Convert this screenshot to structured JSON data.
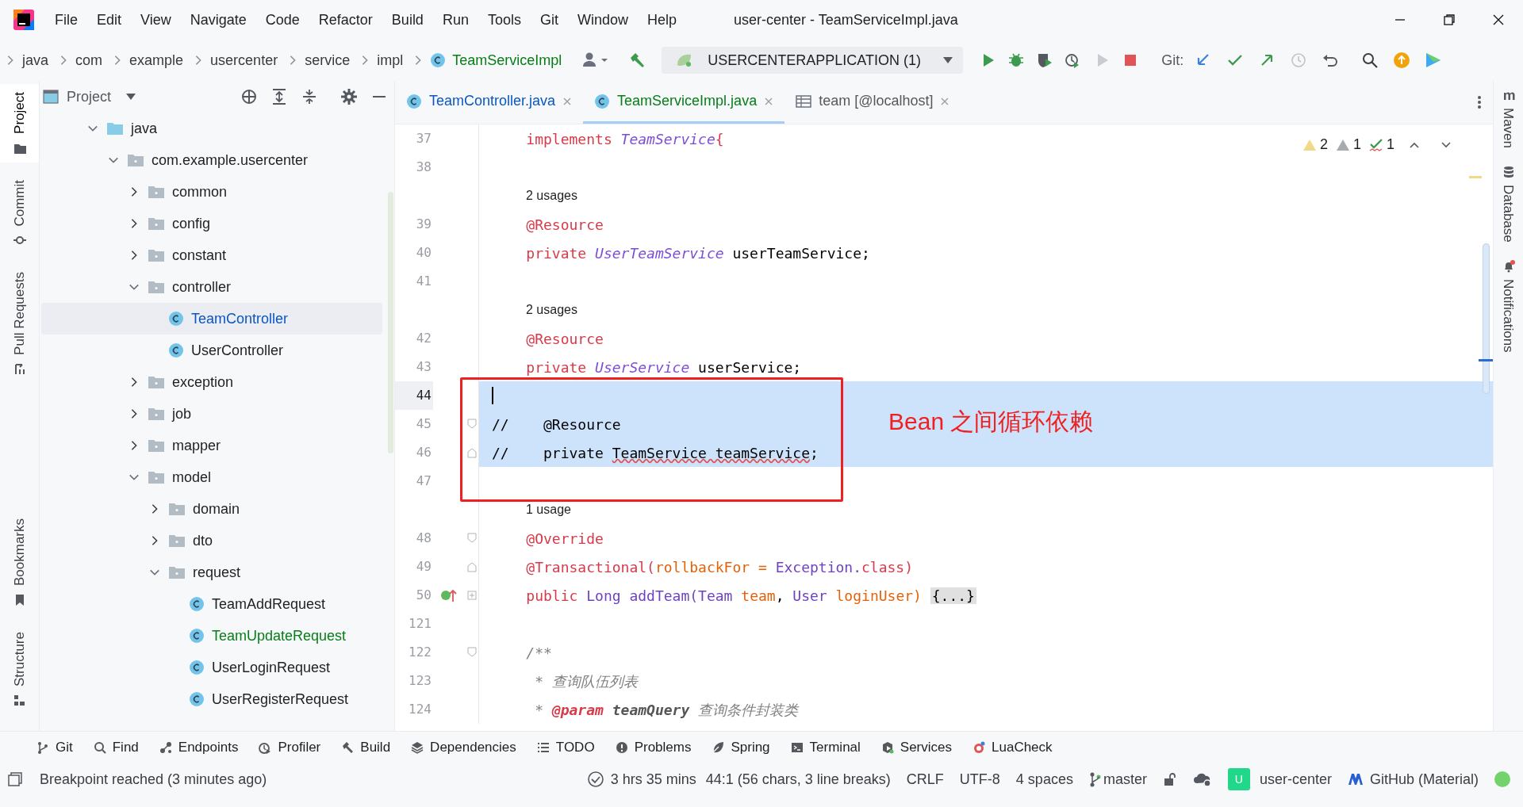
{
  "window": {
    "title": "user-center - TeamServiceImpl.java"
  },
  "menu": [
    "File",
    "Edit",
    "View",
    "Navigate",
    "Code",
    "Refactor",
    "Build",
    "Run",
    "Tools",
    "Git",
    "Window",
    "Help"
  ],
  "breadcrumbs": [
    {
      "label": "java",
      "kind": "folder"
    },
    {
      "label": "com",
      "kind": "folder"
    },
    {
      "label": "example",
      "kind": "folder"
    },
    {
      "label": "usercenter",
      "kind": "folder"
    },
    {
      "label": "service",
      "kind": "folder"
    },
    {
      "label": "impl",
      "kind": "folder"
    },
    {
      "label": "TeamServiceImpl",
      "kind": "class"
    }
  ],
  "run_config": {
    "label": "USERCENTERAPPLICATION (1)"
  },
  "git_label": "Git:",
  "left_stripe": {
    "top": [
      {
        "label": "Project",
        "selected": true
      },
      {
        "label": "Commit",
        "selected": false
      },
      {
        "label": "Pull Requests",
        "selected": false
      }
    ],
    "bottom": [
      {
        "label": "Bookmarks",
        "selected": false
      },
      {
        "label": "Structure",
        "selected": false
      }
    ]
  },
  "right_stripe": [
    {
      "label": "Maven",
      "badge": false
    },
    {
      "label": "Database",
      "badge": false
    },
    {
      "label": "Notifications",
      "badge": true
    }
  ],
  "project_panel": {
    "title": "Project",
    "tree": [
      {
        "label": "java",
        "kind": "source-root",
        "expanded": true,
        "selected": false,
        "modified": false,
        "added": false,
        "children": [
          {
            "label": "com.example.usercenter",
            "kind": "package",
            "expanded": true,
            "selected": false,
            "modified": false,
            "added": false,
            "children": [
              {
                "label": "common",
                "kind": "package",
                "expanded": false,
                "selected": false,
                "modified": false,
                "added": false
              },
              {
                "label": "config",
                "kind": "package",
                "expanded": false,
                "selected": false,
                "modified": false,
                "added": false
              },
              {
                "label": "constant",
                "kind": "package",
                "expanded": false,
                "selected": false,
                "modified": false,
                "added": false
              },
              {
                "label": "controller",
                "kind": "package",
                "expanded": true,
                "selected": false,
                "modified": false,
                "added": false,
                "children": [
                  {
                    "label": "TeamController",
                    "kind": "class",
                    "selected": true,
                    "modified": true,
                    "added": false
                  },
                  {
                    "label": "UserController",
                    "kind": "class",
                    "selected": false,
                    "modified": false,
                    "added": false
                  }
                ]
              },
              {
                "label": "exception",
                "kind": "package",
                "expanded": false,
                "selected": false,
                "modified": false,
                "added": false
              },
              {
                "label": "job",
                "kind": "package",
                "expanded": false,
                "selected": false,
                "modified": false,
                "added": false
              },
              {
                "label": "mapper",
                "kind": "package",
                "expanded": false,
                "selected": false,
                "modified": false,
                "added": false
              },
              {
                "label": "model",
                "kind": "package",
                "expanded": true,
                "selected": false,
                "modified": false,
                "added": false,
                "children": [
                  {
                    "label": "domain",
                    "kind": "package",
                    "expanded": false,
                    "selected": false,
                    "modified": false,
                    "added": false
                  },
                  {
                    "label": "dto",
                    "kind": "package",
                    "expanded": false,
                    "selected": false,
                    "modified": false,
                    "added": false
                  },
                  {
                    "label": "request",
                    "kind": "package",
                    "expanded": true,
                    "selected": false,
                    "modified": false,
                    "added": false,
                    "children": [
                      {
                        "label": "TeamAddRequest",
                        "kind": "class",
                        "selected": false,
                        "modified": false,
                        "added": false
                      },
                      {
                        "label": "TeamUpdateRequest",
                        "kind": "class",
                        "selected": false,
                        "modified": false,
                        "added": true
                      },
                      {
                        "label": "UserLoginRequest",
                        "kind": "class",
                        "selected": false,
                        "modified": false,
                        "added": false
                      },
                      {
                        "label": "UserRegisterRequest",
                        "kind": "class",
                        "selected": false,
                        "modified": false,
                        "added": false
                      }
                    ]
                  }
                ]
              }
            ]
          }
        ]
      }
    ]
  },
  "tabs": [
    {
      "label": "TeamController.java",
      "kind": "class",
      "selected": false,
      "modified": true,
      "added": false
    },
    {
      "label": "TeamServiceImpl.java",
      "kind": "class",
      "selected": true,
      "modified": false,
      "added": true
    },
    {
      "label": "team [@localhost]",
      "kind": "table",
      "selected": false,
      "modified": false,
      "added": false
    }
  ],
  "inspections": {
    "warnings": "2",
    "weak_warnings": "1",
    "typos": "1"
  },
  "code": [
    {
      "kind": "code",
      "number": "37",
      "tokens": [
        {
          "text": "    implements ",
          "kind": "keyword"
        },
        {
          "text": "TeamService",
          "kind": "type"
        },
        {
          "text": "{",
          "kind": "keyword"
        }
      ]
    },
    {
      "kind": "code",
      "number": "38"
    },
    {
      "kind": "usages",
      "text": "2 usages"
    },
    {
      "kind": "code",
      "number": "39",
      "tokens": [
        {
          "text": "    @Resource",
          "kind": "annotation"
        }
      ]
    },
    {
      "kind": "code",
      "number": "40",
      "tokens": [
        {
          "text": "    private ",
          "kind": "keyword"
        },
        {
          "text": "UserTeamService",
          "kind": "type"
        },
        {
          "text": " userTeamService;",
          "kind": "plain"
        }
      ]
    },
    {
      "kind": "code",
      "number": "41"
    },
    {
      "kind": "usages",
      "text": "2 usages"
    },
    {
      "kind": "code",
      "number": "42",
      "tokens": [
        {
          "text": "    @Resource",
          "kind": "annotation"
        }
      ]
    },
    {
      "kind": "code",
      "number": "43",
      "tokens": [
        {
          "text": "    private ",
          "kind": "keyword"
        },
        {
          "text": "UserService",
          "kind": "type"
        },
        {
          "text": " userService;",
          "kind": "plain"
        }
      ]
    },
    {
      "kind": "code",
      "number": "44",
      "highlighted": true,
      "current": true
    },
    {
      "kind": "code",
      "number": "45",
      "tokens": [
        {
          "text": "//    @Resource",
          "kind": "plain"
        }
      ],
      "highlighted": true,
      "fold_open": true
    },
    {
      "kind": "code",
      "number": "46",
      "tokens": [
        {
          "text": "//    private ",
          "kind": "plain"
        },
        {
          "text": "TeamService teamService",
          "kind": "squiggle"
        },
        {
          "text": ";",
          "kind": "plain"
        }
      ],
      "highlighted": true,
      "fold_close": true
    },
    {
      "kind": "code",
      "number": "47"
    },
    {
      "kind": "usages",
      "text": "1 usage"
    },
    {
      "kind": "code",
      "number": "48",
      "tokens": [
        {
          "text": "    @Override",
          "kind": "annotation"
        }
      ],
      "fold_open": true
    },
    {
      "kind": "code",
      "number": "49",
      "tokens": [
        {
          "text": "    @Transactional(",
          "kind": "annotation"
        },
        {
          "text": "rollbackFor = ",
          "kind": "param"
        },
        {
          "text": "Exception.",
          "kind": "class"
        },
        {
          "text": "class",
          "kind": "keyword"
        },
        {
          "text": ")",
          "kind": "annotation"
        }
      ],
      "fold_close": true
    },
    {
      "kind": "code",
      "number": "50",
      "tokens": [
        {
          "text": "    public ",
          "kind": "keyword"
        },
        {
          "text": "Long ",
          "kind": "class"
        },
        {
          "text": "addTeam(",
          "kind": "method"
        },
        {
          "text": "Team ",
          "kind": "class"
        },
        {
          "text": "team",
          "kind": "param"
        },
        {
          "text": ", ",
          "kind": "plain"
        },
        {
          "text": "User ",
          "kind": "class"
        },
        {
          "text": "loginUser) ",
          "kind": "param"
        },
        {
          "text": "{...}",
          "kind": "folded"
        }
      ],
      "collapsed": true,
      "implements": true
    },
    {
      "kind": "code",
      "number": "121"
    },
    {
      "kind": "code",
      "number": "122",
      "tokens": [
        {
          "text": "    /**",
          "kind": "doc"
        }
      ],
      "fold_open": true
    },
    {
      "kind": "code",
      "number": "123",
      "tokens": [
        {
          "text": "     * 查询队伍列表",
          "kind": "doc"
        }
      ]
    },
    {
      "kind": "code",
      "number": "124",
      "tokens": [
        {
          "text": "     * ",
          "kind": "doc"
        },
        {
          "text": "@param",
          "kind": "doctag"
        },
        {
          "text": " teamQuery",
          "kind": "docparam"
        },
        {
          "text": " 查询条件封装类",
          "kind": "doc"
        }
      ]
    }
  ],
  "callout": {
    "text": "Bean 之间循环依赖"
  },
  "tool_windows": [
    "Git",
    "Find",
    "Endpoints",
    "Profiler",
    "Build",
    "Dependencies",
    "TODO",
    "Problems",
    "Spring",
    "Terminal",
    "Services",
    "LuaCheck"
  ],
  "status_bar": {
    "message": "Breakpoint reached (3 minutes ago)",
    "timer": "3 hrs 35 mins",
    "position": "44:1 (56 chars, 3 line breaks)",
    "line_separator": "CRLF",
    "encoding": "UTF-8",
    "indent": "4 spaces",
    "branch": "master",
    "avatar": "U",
    "user": "user-center",
    "theme": "GitHub (Material)"
  }
}
